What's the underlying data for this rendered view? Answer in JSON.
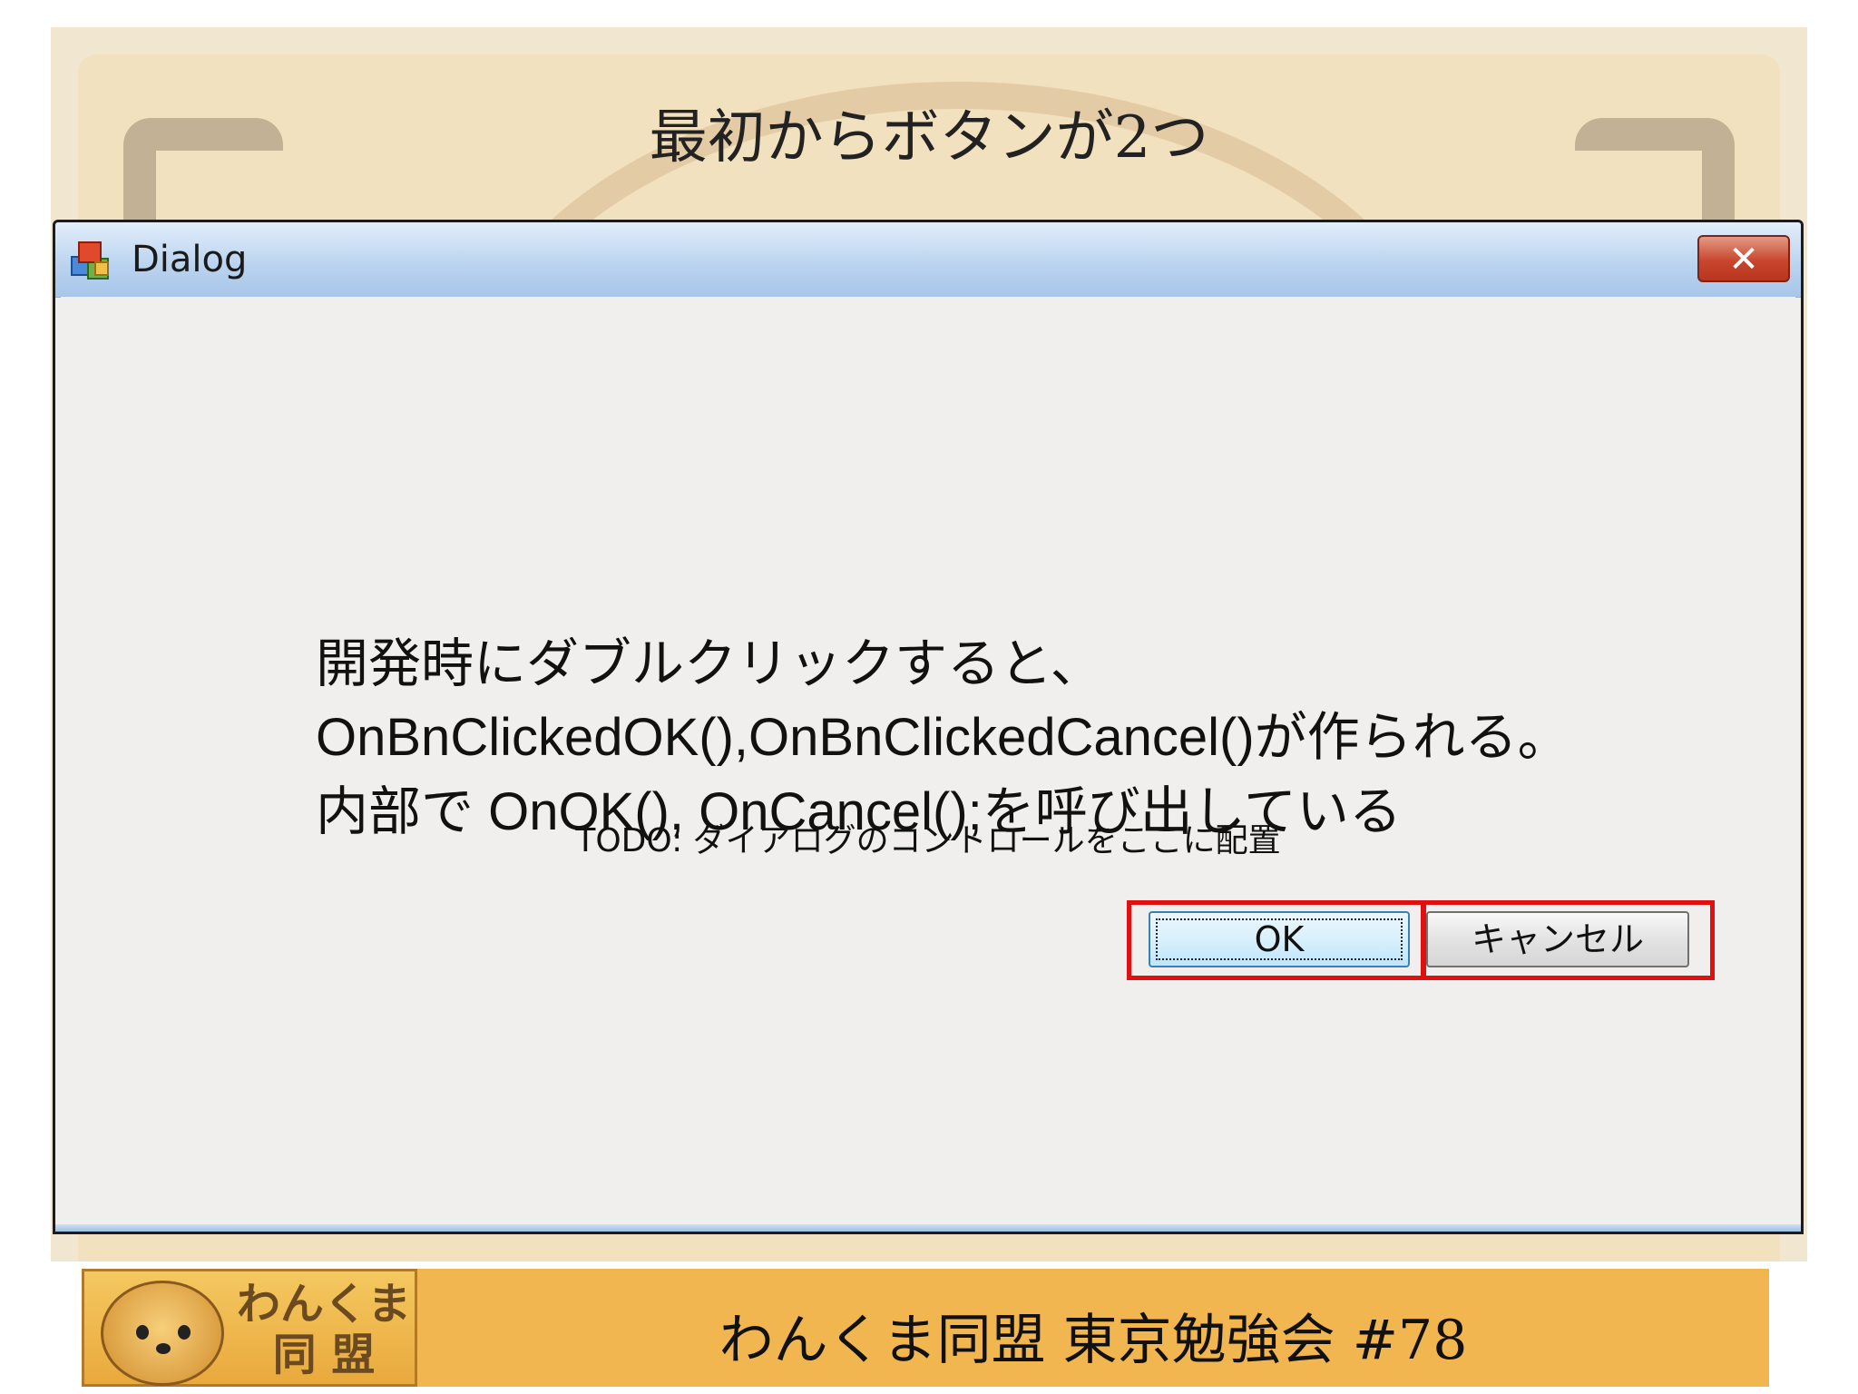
{
  "slide": {
    "title": "最初からボタンが2つ"
  },
  "dialog": {
    "title": "Dialog",
    "close_label": "✕",
    "todo_text": "TODO: ダイアログのコントロールをここに配置",
    "ok_label": "OK",
    "cancel_label": "キャンセル"
  },
  "note": {
    "line1": "開発時にダブルクリックすると、",
    "line2": "OnBnClickedOK(),OnBnClickedCancel()が作られる。",
    "line3": "内部で OnOK(), OnCancel();を呼び出している"
  },
  "footer": {
    "logo_text_line1": "わんくま",
    "logo_text_line2": "同 盟",
    "text": "わんくま同盟 東京勉強会 #78"
  },
  "colors": {
    "highlight": "#e01010",
    "footer_bg": "#f1b64f",
    "titlebar": "#b9d2ee"
  }
}
